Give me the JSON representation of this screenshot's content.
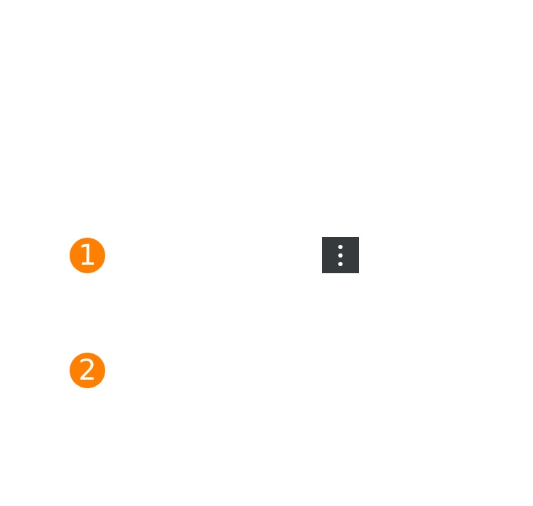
{
  "steps": [
    {
      "number": "1"
    },
    {
      "number": "2"
    }
  ],
  "menu_button": {
    "icon": "more-vertical-icon"
  },
  "colors": {
    "badge": "#ff8000",
    "menu_button_bg": "#363a3d",
    "menu_button_icon": "#ffffff",
    "background": "#ffffff"
  }
}
